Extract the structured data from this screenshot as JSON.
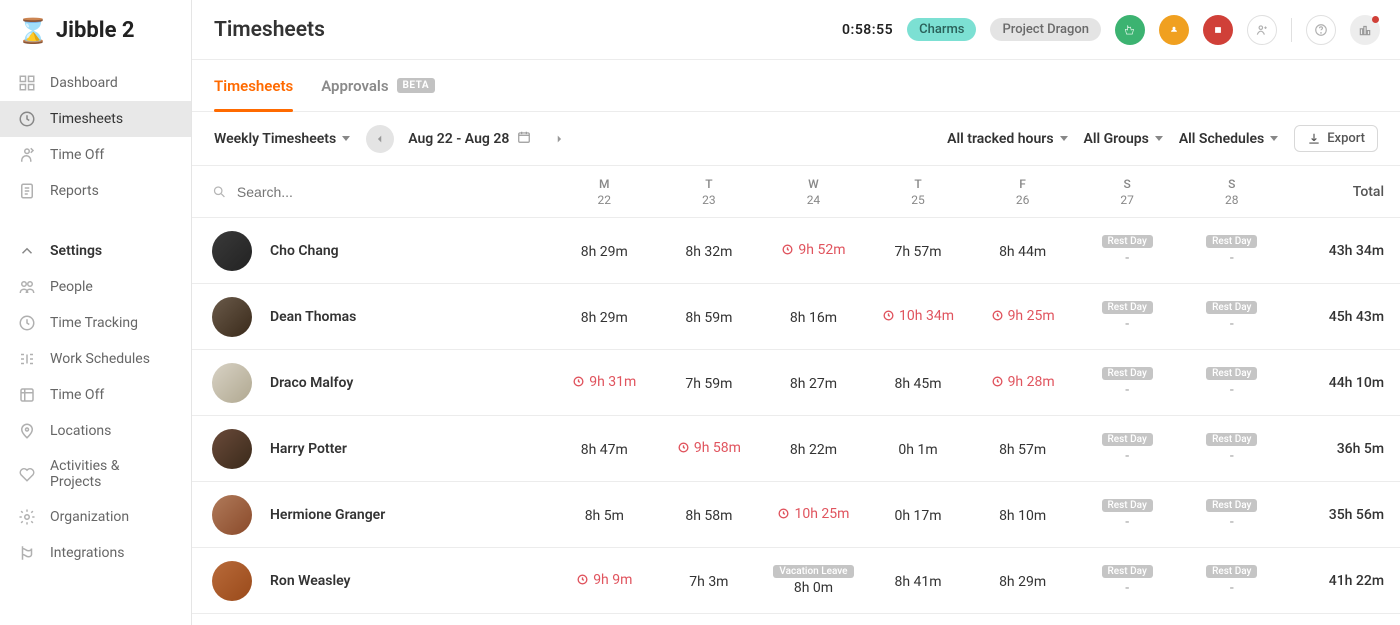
{
  "brand": "Jibble 2",
  "page": {
    "title": "Timesheets"
  },
  "sidebar": {
    "items": [
      {
        "label": "Dashboard"
      },
      {
        "label": "Timesheets"
      },
      {
        "label": "Time Off"
      },
      {
        "label": "Reports"
      },
      {
        "label": "Settings"
      },
      {
        "label": "People"
      },
      {
        "label": "Time Tracking"
      },
      {
        "label": "Work Schedules"
      },
      {
        "label": "Time Off"
      },
      {
        "label": "Locations"
      },
      {
        "label": "Activities & Projects"
      },
      {
        "label": "Organization"
      },
      {
        "label": "Integrations"
      }
    ]
  },
  "header": {
    "timer": "0:58:55",
    "activity": "Charms",
    "project": "Project Dragon"
  },
  "tabs": [
    {
      "label": "Timesheets"
    },
    {
      "label": "Approvals",
      "badge": "BETA"
    }
  ],
  "filters": {
    "view": "Weekly Timesheets",
    "date_range": "Aug 22 - Aug 28",
    "hours": "All tracked hours",
    "groups": "All Groups",
    "schedules": "All Schedules",
    "export": "Export"
  },
  "search": {
    "placeholder": "Search..."
  },
  "days": [
    {
      "dow": "M",
      "num": "22"
    },
    {
      "dow": "T",
      "num": "23"
    },
    {
      "dow": "W",
      "num": "24"
    },
    {
      "dow": "T",
      "num": "25"
    },
    {
      "dow": "F",
      "num": "26"
    },
    {
      "dow": "S",
      "num": "27"
    },
    {
      "dow": "S",
      "num": "28"
    }
  ],
  "total_label": "Total",
  "badges": {
    "rest": "Rest Day",
    "vacation": "Vacation Leave"
  },
  "rows": [
    {
      "name": "Cho Chang",
      "total": "43h 34m",
      "cells": [
        {
          "t": "v",
          "v": "8h 29m"
        },
        {
          "t": "v",
          "v": "8h 32m"
        },
        {
          "t": "w",
          "v": "9h 52m"
        },
        {
          "t": "v",
          "v": "7h 57m"
        },
        {
          "t": "v",
          "v": "8h 44m"
        },
        {
          "t": "rest"
        },
        {
          "t": "rest"
        }
      ]
    },
    {
      "name": "Dean Thomas",
      "total": "45h 43m",
      "cells": [
        {
          "t": "v",
          "v": "8h 29m"
        },
        {
          "t": "v",
          "v": "8h 59m"
        },
        {
          "t": "v",
          "v": "8h 16m"
        },
        {
          "t": "w",
          "v": "10h 34m"
        },
        {
          "t": "w",
          "v": "9h 25m"
        },
        {
          "t": "rest"
        },
        {
          "t": "rest"
        }
      ]
    },
    {
      "name": "Draco Malfoy",
      "total": "44h 10m",
      "cells": [
        {
          "t": "w",
          "v": "9h 31m"
        },
        {
          "t": "v",
          "v": "7h 59m"
        },
        {
          "t": "v",
          "v": "8h 27m"
        },
        {
          "t": "v",
          "v": "8h 45m"
        },
        {
          "t": "w",
          "v": "9h 28m"
        },
        {
          "t": "rest"
        },
        {
          "t": "rest"
        }
      ]
    },
    {
      "name": "Harry Potter",
      "total": "36h 5m",
      "cells": [
        {
          "t": "v",
          "v": "8h 47m"
        },
        {
          "t": "w",
          "v": "9h 58m"
        },
        {
          "t": "v",
          "v": "8h 22m"
        },
        {
          "t": "v",
          "v": "0h 1m"
        },
        {
          "t": "v",
          "v": "8h 57m"
        },
        {
          "t": "rest"
        },
        {
          "t": "rest"
        }
      ]
    },
    {
      "name": "Hermione Granger",
      "total": "35h 56m",
      "cells": [
        {
          "t": "v",
          "v": "8h 5m"
        },
        {
          "t": "v",
          "v": "8h 58m"
        },
        {
          "t": "w",
          "v": "10h 25m"
        },
        {
          "t": "v",
          "v": "0h 17m"
        },
        {
          "t": "v",
          "v": "8h 10m"
        },
        {
          "t": "rest"
        },
        {
          "t": "rest"
        }
      ]
    },
    {
      "name": "Ron Weasley",
      "total": "41h 22m",
      "cells": [
        {
          "t": "w",
          "v": "9h 9m"
        },
        {
          "t": "v",
          "v": "7h 3m"
        },
        {
          "t": "vac",
          "v": "8h 0m"
        },
        {
          "t": "v",
          "v": "8h 41m"
        },
        {
          "t": "v",
          "v": "8h 29m"
        },
        {
          "t": "rest"
        },
        {
          "t": "rest"
        }
      ]
    }
  ]
}
